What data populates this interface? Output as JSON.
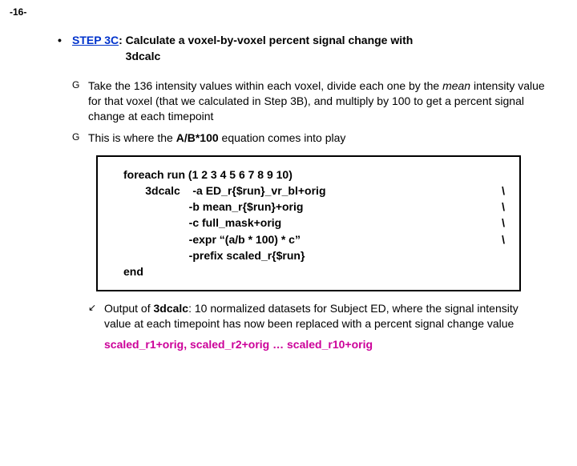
{
  "page_number": "-16-",
  "step": {
    "label": "STEP 3C",
    "sep": ": ",
    "title_rest": "Calculate a voxel-by-voxel percent signal change with",
    "title_line2": "3dcalc"
  },
  "subs": {
    "a": {
      "pre": "Take the 136 intensity values within each voxel, divide each one by the ",
      "mean": "mean",
      "post": " intensity value for that voxel (that we calculated in Step 3B), and multiply by 100 to get a percent signal change at each timepoint"
    },
    "b": {
      "pre": "This is where the ",
      "eq": "A/B*100",
      "post": " equation comes into play"
    }
  },
  "code": {
    "l1": "foreach run (1 2 3 4 5 6 7 8 9 10)",
    "l2": "       3dcalc    -a ED_r{$run}_vr_bl+orig",
    "l3": "                     -b mean_r{$run}+orig",
    "l4": "                     -c full_mask+orig",
    "l5": "                     -expr “(a/b * 100) * c”",
    "l6": "                     -prefix scaled_r{$run}",
    "l7": "end",
    "bs": "\\"
  },
  "output": {
    "pre": "Output of ",
    "cmd": "3dcalc",
    "post": ": 10 normalized datasets for Subject ED, where the signal intensity value at each timepoint has now been replaced with a percent signal change value",
    "files": "scaled_r1+orig, scaled_r2+orig … scaled_r10+orig"
  }
}
